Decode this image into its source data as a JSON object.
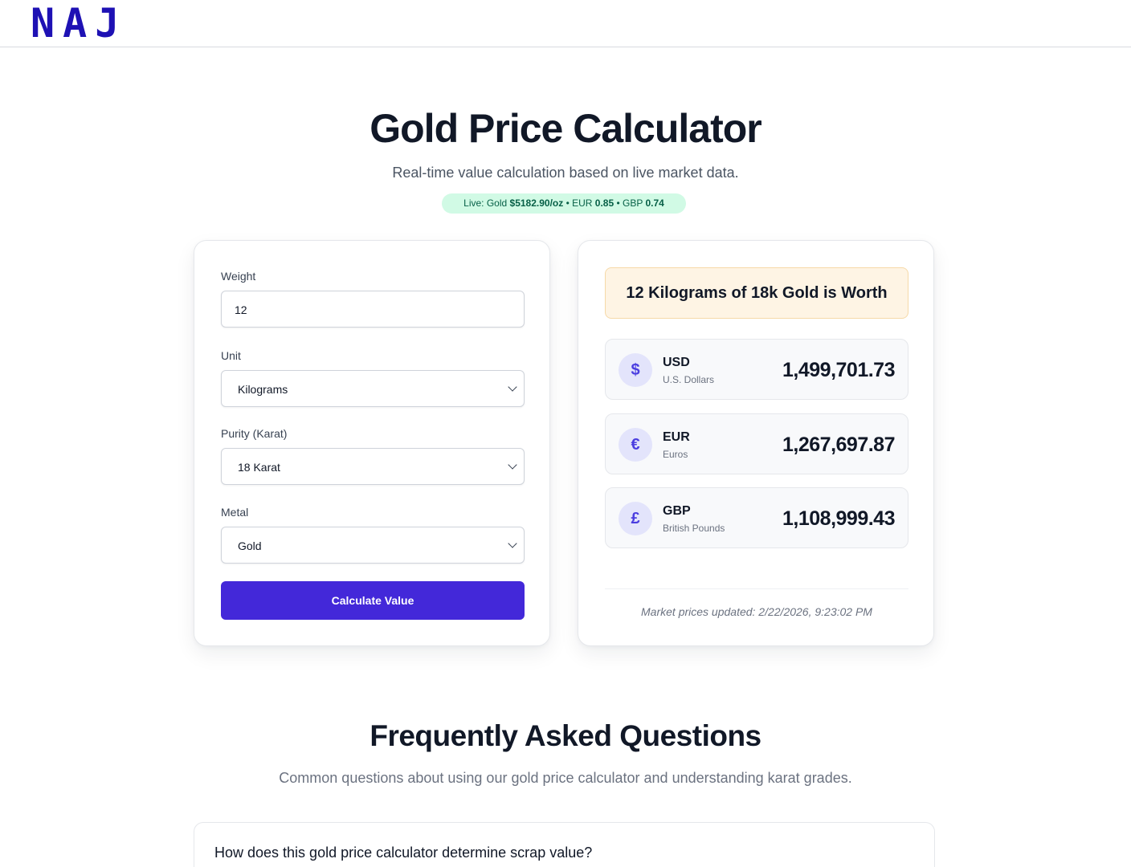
{
  "header": {
    "logo": "NAJ"
  },
  "hero": {
    "title": "Gold Price Calculator",
    "subtitle": "Real-time value calculation based on live market data.",
    "live": {
      "prefix": "Live: Gold ",
      "gold_price": "$5182.90/oz",
      "eur_label": " • EUR ",
      "eur_rate": "0.85",
      "gbp_label": " • GBP ",
      "gbp_rate": "0.74"
    }
  },
  "form": {
    "weight_label": "Weight",
    "weight_value": "12",
    "unit_label": "Unit",
    "unit_value": "Kilograms",
    "purity_label": "Purity (Karat)",
    "purity_value": "18 Karat",
    "metal_label": "Metal",
    "metal_value": "Gold",
    "calculate_label": "Calculate Value"
  },
  "result": {
    "heading": "12 Kilograms of 18k Gold is Worth",
    "currencies": [
      {
        "symbol": "$",
        "code": "USD",
        "name": "U.S. Dollars",
        "amount": "1,499,701.73",
        "icon": "dollar-icon"
      },
      {
        "symbol": "€",
        "code": "EUR",
        "name": "Euros",
        "amount": "1,267,697.87",
        "icon": "euro-icon"
      },
      {
        "symbol": "£",
        "code": "GBP",
        "name": "British Pounds",
        "amount": "1,108,999.43",
        "icon": "pound-icon"
      }
    ],
    "updated": "Market prices updated: 2/22/2026, 9:23:02 PM"
  },
  "faq": {
    "title": "Frequently Asked Questions",
    "subtitle": "Common questions about using our gold price calculator and understanding karat grades.",
    "items": [
      {
        "question": "How does this gold price calculator determine scrap value?"
      }
    ]
  },
  "colors": {
    "brand": "#1e11b4",
    "accent": "#4328d9",
    "live_bg": "#d1fae5",
    "live_text": "#065f46",
    "worth_bg": "#fef4e4"
  }
}
